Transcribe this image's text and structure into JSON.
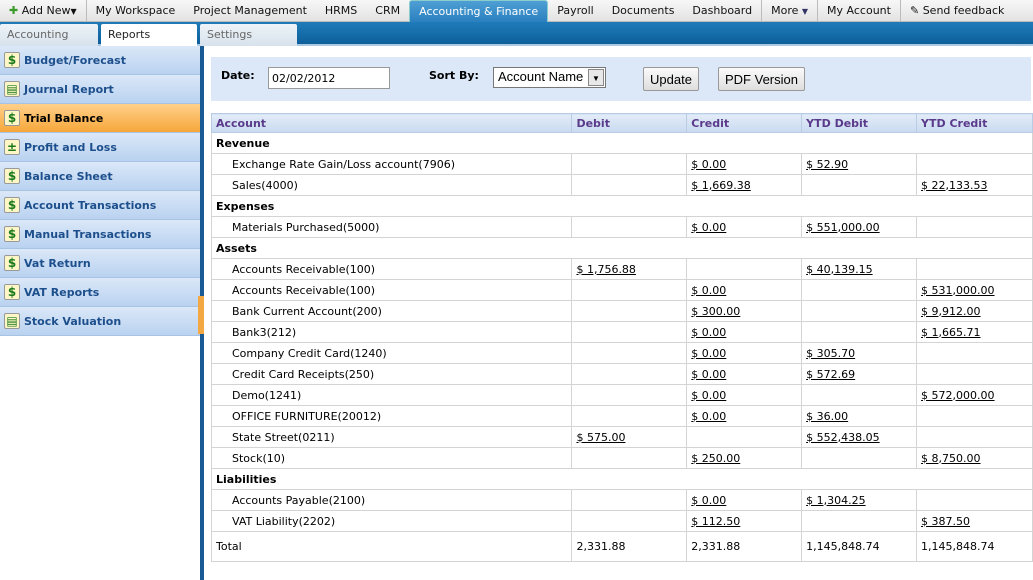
{
  "topnav": {
    "add_new": "Add New",
    "items": [
      "My Workspace",
      "Project Management",
      "HRMS",
      "CRM",
      "Accounting & Finance",
      "Payroll",
      "Documents",
      "Dashboard"
    ],
    "more": "More",
    "my_account": "My Account",
    "feedback": "Send feedback",
    "active": "Accounting & Finance"
  },
  "subtabs": [
    "Accounting",
    "Reports",
    "Settings"
  ],
  "sidebar": {
    "items": [
      {
        "label": "Budget/Forecast",
        "icon": "budget-icon"
      },
      {
        "label": "Journal Report",
        "icon": "journal-icon"
      },
      {
        "label": "Trial Balance",
        "icon": "dollar-icon"
      },
      {
        "label": "Profit and Loss",
        "icon": "profit-loss-icon"
      },
      {
        "label": "Balance Sheet",
        "icon": "dollar-icon"
      },
      {
        "label": "Account Transactions",
        "icon": "transactions-icon"
      },
      {
        "label": "Manual Transactions",
        "icon": "transactions-icon"
      },
      {
        "label": "Vat Return",
        "icon": "transactions-icon"
      },
      {
        "label": "VAT Reports",
        "icon": "transactions-icon"
      },
      {
        "label": "Stock Valuation",
        "icon": "stock-icon"
      }
    ],
    "active": "Trial Balance"
  },
  "filter": {
    "date_label": "Date:",
    "date_value": "02/02/2012",
    "sort_label": "Sort By:",
    "sort_value": "Account Name",
    "update": "Update",
    "pdf": "PDF Version"
  },
  "table": {
    "headers": [
      "Account",
      "Debit",
      "Credit",
      "YTD Debit",
      "YTD Credit"
    ],
    "rows": [
      {
        "group": "Revenue"
      },
      {
        "cells": [
          "Exchange Rate Gain/Loss account(7906)",
          "",
          "$ 0.00",
          "$ 52.90",
          ""
        ]
      },
      {
        "cells": [
          "Sales(4000)",
          "",
          "$ 1,669.38",
          "",
          "$ 22,133.53"
        ]
      },
      {
        "group": "Expenses"
      },
      {
        "cells": [
          "Materials Purchased(5000)",
          "",
          "$ 0.00",
          "$ 551,000.00",
          ""
        ]
      },
      {
        "group": "Assets"
      },
      {
        "cells": [
          "Accounts Receivable(100)",
          "$ 1,756.88",
          "",
          "$ 40,139.15",
          ""
        ]
      },
      {
        "cells": [
          "Accounts Receivable(100)",
          "",
          "$ 0.00",
          "",
          "$ 531,000.00"
        ]
      },
      {
        "cells": [
          "Bank Current Account(200)",
          "",
          "$ 300.00",
          "",
          "$ 9,912.00"
        ]
      },
      {
        "cells": [
          "Bank3(212)",
          "",
          "$ 0.00",
          "",
          "$ 1,665.71"
        ]
      },
      {
        "cells": [
          "Company Credit Card(1240)",
          "",
          "$ 0.00",
          "$ 305.70",
          ""
        ]
      },
      {
        "cells": [
          "Credit Card Receipts(250)",
          "",
          "$ 0.00",
          "$ 572.69",
          ""
        ]
      },
      {
        "cells": [
          "Demo(1241)",
          "",
          "$ 0.00",
          "",
          "$ 572,000.00"
        ]
      },
      {
        "cells": [
          "OFFICE FURNITURE(20012)",
          "",
          "$ 0.00",
          "$ 36.00",
          ""
        ]
      },
      {
        "cells": [
          "State Street(0211)",
          "$ 575.00",
          "",
          "$ 552,438.05",
          ""
        ]
      },
      {
        "cells": [
          "Stock(10)",
          "",
          "$ 250.00",
          "",
          "$ 8,750.00"
        ]
      },
      {
        "group": "Liabilities"
      },
      {
        "cells": [
          "Accounts Payable(2100)",
          "",
          "$ 0.00",
          "$ 1,304.25",
          ""
        ]
      },
      {
        "cells": [
          "VAT Liability(2202)",
          "",
          "$ 112.50",
          "",
          "$ 387.50"
        ]
      }
    ],
    "total": [
      "Total",
      "2,331.88",
      "2,331.88",
      "1,145,848.74",
      "1,145,848.74"
    ]
  }
}
